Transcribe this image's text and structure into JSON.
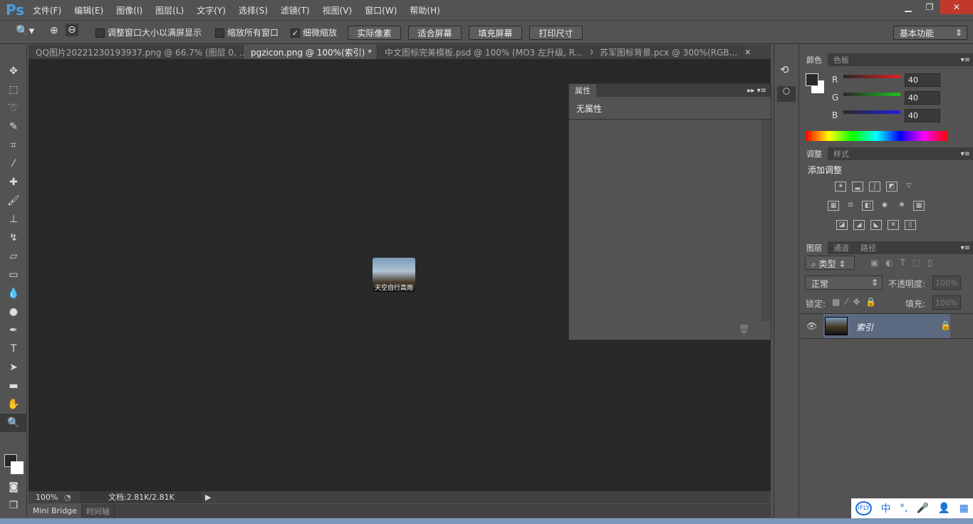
{
  "app": {
    "logo": "Ps"
  },
  "menu": [
    "文件(F)",
    "编辑(E)",
    "图像(I)",
    "图层(L)",
    "文字(Y)",
    "选择(S)",
    "滤镜(T)",
    "视图(V)",
    "窗口(W)",
    "帮助(H)"
  ],
  "window_controls": {
    "minimize": "▁",
    "restore": "❐",
    "close": "✕"
  },
  "options": {
    "resize_windows": {
      "label": "调整窗口大小以满屏显示",
      "checked": false
    },
    "zoom_all": {
      "label": "缩放所有窗口",
      "checked": false
    },
    "scrubby_zoom": {
      "label": "细微缩放",
      "checked": true
    },
    "buttons": [
      "实际像素",
      "适合屏幕",
      "填充屏幕",
      "打印尺寸"
    ],
    "workspace": "基本功能"
  },
  "tabs": [
    {
      "label": "QQ图片20221230193937.png @ 66.7% (图层 0, ...",
      "active": false
    },
    {
      "label": "pgzicon.png @ 100%(索引) *",
      "active": true
    },
    {
      "label": "中文图标完美模板.psd @ 100% (MO3 左升级, R...",
      "active": false
    },
    {
      "label": "苏军图标背景.pcx @ 300%(RGB...",
      "active": false
    }
  ],
  "canvas": {
    "image_caption": "天空自行高炮"
  },
  "status": {
    "zoom": "100%",
    "doc": "文档:2.81K/2.81K"
  },
  "bottom_tabs": [
    "Mini Bridge",
    "时间轴"
  ],
  "properties": {
    "tab": "属性",
    "content": "无属性"
  },
  "color_panel": {
    "tabs": [
      "颜色",
      "色板"
    ],
    "channels": [
      {
        "label": "R",
        "value": "40",
        "color": "#e02020"
      },
      {
        "label": "G",
        "value": "40",
        "color": "#20c020"
      },
      {
        "label": "B",
        "value": "40",
        "color": "#2020e0"
      }
    ],
    "foreground": "#282828",
    "background": "#ffffff"
  },
  "adjust_panel": {
    "tabs": [
      "调整",
      "样式"
    ],
    "title": "添加调整"
  },
  "layers_panel": {
    "tabs": [
      "图层",
      "通道",
      "路径"
    ],
    "filter": "类型",
    "blend_mode": "正常",
    "opacity_label": "不透明度:",
    "opacity": "100%",
    "lock_label": "锁定:",
    "fill_label": "填充:",
    "fill": "100%",
    "layers": [
      {
        "name": "索引",
        "visible": true,
        "locked": true
      }
    ]
  },
  "ime": {
    "items": [
      "中",
      "°,",
      "🎤",
      "👤",
      "▦"
    ]
  }
}
